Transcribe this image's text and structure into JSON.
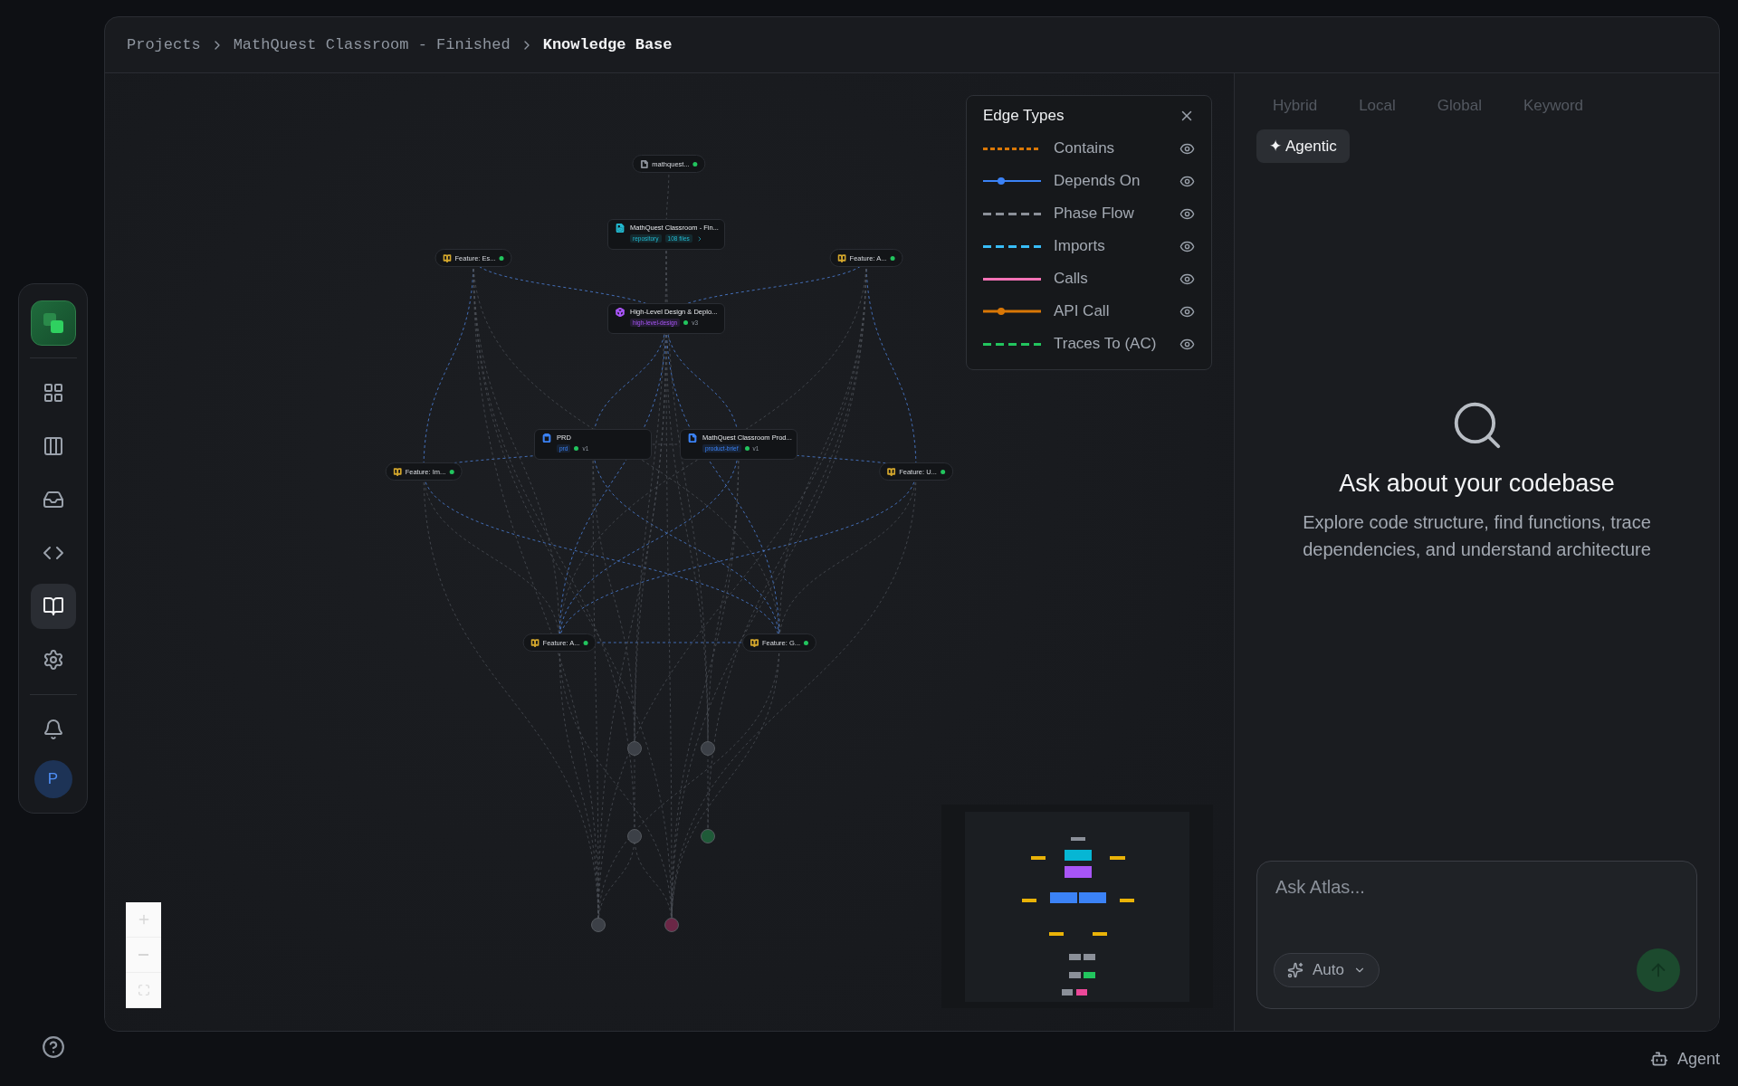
{
  "breadcrumb": [
    {
      "label": "Projects",
      "current": false
    },
    {
      "label": "MathQuest Classroom - Finished",
      "current": false
    },
    {
      "label": "Knowledge Base",
      "current": true
    }
  ],
  "sidebar": {
    "nav_items": [
      {
        "selected": false
      },
      {
        "selected": false
      },
      {
        "selected": false
      },
      {
        "selected": false
      },
      {
        "selected": true
      },
      {
        "selected": false
      },
      {
        "selected": false
      }
    ],
    "avatar": {
      "initial": "P"
    }
  },
  "graph": {
    "nodes": [
      {
        "kind": "pill",
        "label": "mathquest...",
        "color": "#8b9099",
        "status_dot": true
      },
      {
        "kind": "card",
        "label": "MathQuest Classroom - Fin...",
        "color": "#22b8cf",
        "tags": [
          "repository",
          "108 files"
        ],
        "more": true
      },
      {
        "kind": "pill",
        "label": "Feature: Es...",
        "color": "#d4a72c",
        "status_dot": true
      },
      {
        "kind": "pill",
        "label": "Feature: A...",
        "color": "#d4a72c",
        "status_dot": true
      },
      {
        "kind": "card",
        "label": "High-Level Design & Deplo...",
        "color": "#a855f7",
        "tags": [
          "high-level-design"
        ],
        "status_dot": true,
        "version": "v3"
      },
      {
        "kind": "card",
        "label": "PRD",
        "color": "#3b82f6",
        "tags": [
          "prd"
        ],
        "status_dot": true,
        "version": "v1"
      },
      {
        "kind": "card",
        "label": "MathQuest Classroom Prod...",
        "color": "#3b82f6",
        "tags": [
          "product-brief"
        ],
        "status_dot": true,
        "version": "v1"
      },
      {
        "kind": "pill",
        "label": "Feature: Im...",
        "color": "#d4a72c",
        "status_dot": true
      },
      {
        "kind": "pill",
        "label": "Feature: U...",
        "color": "#d4a72c",
        "status_dot": true
      },
      {
        "kind": "pill",
        "label": "Feature: A...",
        "color": "#d4a72c",
        "status_dot": true
      },
      {
        "kind": "pill",
        "label": "Feature: G...",
        "color": "#d4a72c",
        "status_dot": true
      },
      {
        "kind": "circle",
        "color": "#3c4047"
      },
      {
        "kind": "circle",
        "color": "#3c4047"
      },
      {
        "kind": "circle",
        "color": "#3c4047"
      },
      {
        "kind": "circle",
        "color": "#1f5a38"
      },
      {
        "kind": "circle",
        "color": "#3c4047"
      },
      {
        "kind": "circle",
        "color": "#6b2746"
      }
    ]
  },
  "legend": {
    "title": "Edge Types",
    "items": [
      {
        "label": "Contains",
        "kind": "dashed",
        "color": "#d97706",
        "visible": true
      },
      {
        "label": "Depends On",
        "kind": "dotted",
        "color": "#3b82f6",
        "visible": true
      },
      {
        "label": "Phase Flow",
        "kind": "longdash",
        "color": "#8b9099",
        "visible": true
      },
      {
        "label": "Imports",
        "kind": "longdash",
        "color": "#38bdf8",
        "visible": true
      },
      {
        "label": "Calls",
        "kind": "solid",
        "color": "#f472b6",
        "visible": true
      },
      {
        "label": "API Call",
        "kind": "dotted",
        "color": "#d97706",
        "visible": true
      },
      {
        "label": "Traces To (AC)",
        "kind": "longdash",
        "color": "#22c55e",
        "visible": true
      }
    ]
  },
  "chat": {
    "modes": [
      {
        "label": "Hybrid",
        "selected": false
      },
      {
        "label": "Local",
        "selected": false
      },
      {
        "label": "Global",
        "selected": false
      },
      {
        "label": "Keyword",
        "selected": false
      },
      {
        "label": "✦ Agentic",
        "selected": true
      }
    ],
    "empty_title": "Ask about your codebase",
    "empty_text": "Explore code structure, find functions, trace dependencies, and understand architecture",
    "input": {
      "placeholder": "Ask Atlas..."
    },
    "model": "Auto"
  },
  "footer": {
    "agent_label": "Agent"
  }
}
